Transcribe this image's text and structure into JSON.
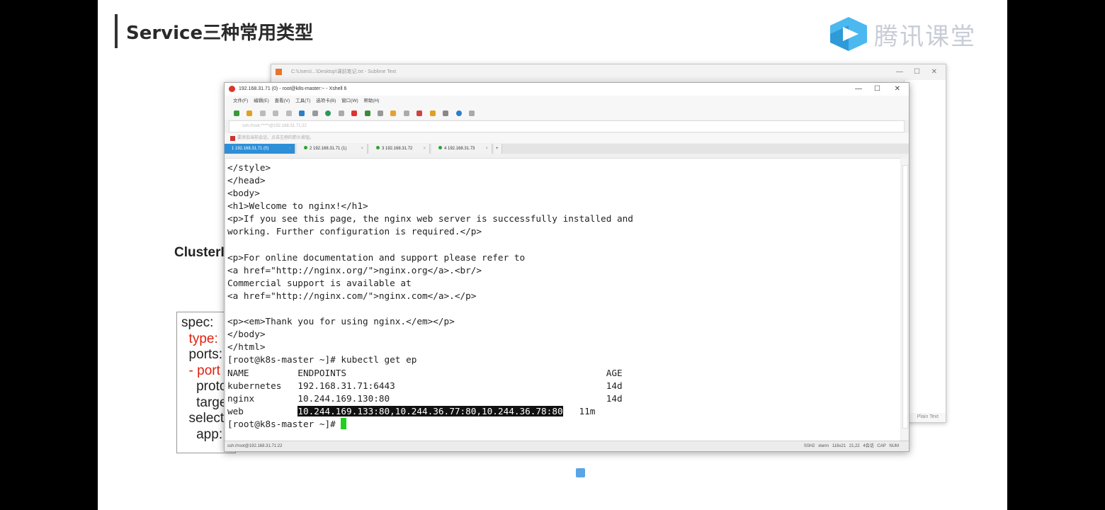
{
  "slide": {
    "title": "Service三种常用类型",
    "cluster_label": "ClusterI",
    "yaml_lines": [
      {
        "text": "spec:",
        "red": false
      },
      {
        "text": "  type:",
        "red": true
      },
      {
        "text": "  ports:",
        "red": false
      },
      {
        "text": "  - port",
        "red": true
      },
      {
        "text": "    proto",
        "red": false
      },
      {
        "text": "    targe",
        "red": false
      },
      {
        "text": "  select",
        "red": false
      },
      {
        "text": "    app:",
        "red": false
      }
    ]
  },
  "logo": {
    "text": "腾讯课堂",
    "icon": "play-icon",
    "color": "#4bb8f0"
  },
  "sublime": {
    "title": "C:\\Users\\...\\Desktop\\课前笔记.txt - Sublime Text",
    "status_right": "Plain Text"
  },
  "xshell": {
    "title": "192.168.31.71 (0) - root@k8s-master:~ - Xshell 6",
    "menu": [
      "文件(F)",
      "编辑(E)",
      "查看(V)",
      "工具(T)",
      "选项卡(B)",
      "窗口(W)",
      "帮助(H)"
    ],
    "address": "ssh://root:*****@192.168.31.71:22",
    "note": "要添加当前会话，点击左侧的箭头按钮。",
    "tabs": [
      {
        "label": "1 192.168.31.71 (0)",
        "active": true
      },
      {
        "label": "2 192.168.31.71 (1)",
        "active": false
      },
      {
        "label": "3 192.168.31.72",
        "active": false
      },
      {
        "label": "4 192.168.31.73",
        "active": false
      }
    ],
    "terminal_lines": [
      "</style>",
      "</head>",
      "<body>",
      "<h1>Welcome to nginx!</h1>",
      "<p>If you see this page, the nginx web server is successfully installed and",
      "working. Further configuration is required.</p>",
      "",
      "<p>For online documentation and support please refer to",
      "<a href=\"http://nginx.org/\">nginx.org</a>.<br/>",
      "Commercial support is available at",
      "<a href=\"http://nginx.com/\">nginx.com</a>.</p>",
      "",
      "<p><em>Thank you for using nginx.</em></p>",
      "</body>",
      "</html>",
      "[root@k8s-master ~]# kubectl get ep",
      "NAME         ENDPOINTS                                                AGE",
      "kubernetes   192.168.31.71:6443                                       14d",
      "nginx        10.244.169.130:80                                        14d"
    ],
    "web_row": {
      "name": "web          ",
      "endpoints": "10.244.169.133:80,10.244.36.77:80,10.244.36.78:80",
      "age": "   11m"
    },
    "prompt": "[root@k8s-master ~]# ",
    "status_left": "ssh://root@192.168.31.71:22",
    "status_right": "SSH2  xterm  116x21  21,22  4会话  CAP  NUM"
  }
}
